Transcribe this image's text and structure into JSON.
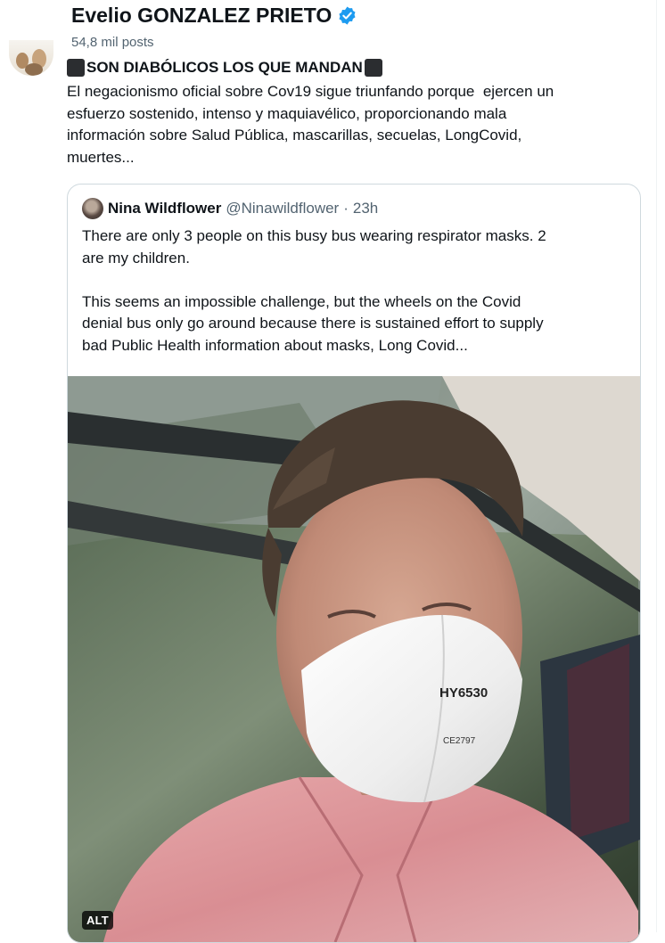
{
  "header": {
    "display_name": "Evelio GONZALEZ PRIETO",
    "posts_count": "54,8 mil posts",
    "verified_icon": "verified-badge-icon"
  },
  "tweet": {
    "headline": "SON DIABÓLICOS LOS QUE MANDAN",
    "headline_icon": "black-square-icon",
    "body": "El negacionismo oficial sobre Cov19 sigue triunfando porque  ejercen un\nesfuerzo sostenido, intenso y maquiavélico, proporcionando mala\ninformación sobre Salud Pública, mascarillas, secuelas, LongCovid,\nmuertes..."
  },
  "quote": {
    "author_name": "Nina Wildflower",
    "author_handle": "@Ninawildflower",
    "separator": "·",
    "time": "23h",
    "body": "There are only 3 people on this busy bus wearing respirator masks. 2\nare my children.\n\nThis seems an impossible challenge, but the wheels on the Covid\ndenial bus only go around because there is sustained effort to supply\nbad Public Health information about masks, Long Covid...",
    "photo": {
      "mask_text": "HY6530",
      "mask_mark": "CE2797",
      "alt_label": "ALT"
    }
  },
  "colors": {
    "text": "#0f1419",
    "secondary": "#536471",
    "verified": "#1d9bf0",
    "border": "#cfd9de"
  }
}
